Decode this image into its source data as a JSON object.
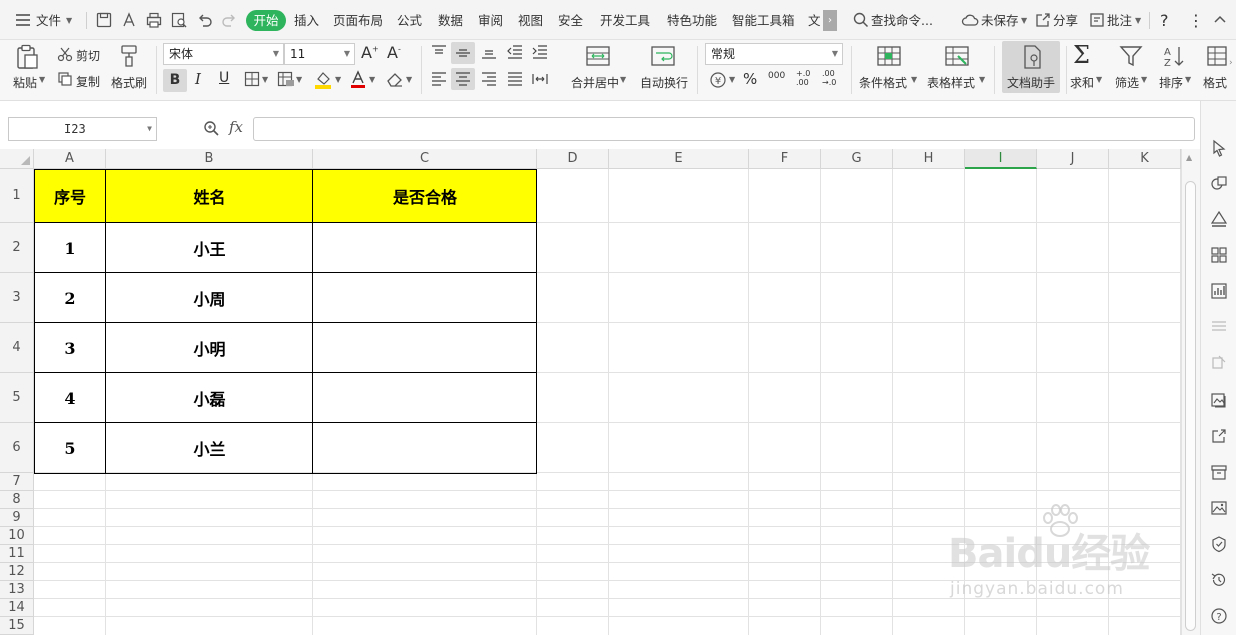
{
  "menubar": {
    "file_label": "文件",
    "tabs": [
      "开始",
      "插入",
      "页面布局",
      "公式",
      "数据",
      "审阅",
      "视图",
      "安全",
      "开发工具",
      "特色功能",
      "智能工具箱",
      "文"
    ],
    "active_tab": "开始",
    "search_placeholder": "查找命令...",
    "unsaved_label": "未保存",
    "share_label": "分享",
    "comment_label": "批注",
    "help_label": "?"
  },
  "ribbon": {
    "paste": "粘贴",
    "cut": "剪切",
    "copy": "复制",
    "format_painter": "格式刷",
    "font_name": "宋体",
    "font_size": "11",
    "bold": "B",
    "italic": "I",
    "underline": "U",
    "merge_center": "合并居中",
    "wrap_text": "自动换行",
    "number_format": "常规",
    "currency": "¥",
    "percent": "%",
    "thousands": "000",
    "inc_decimal": "+.0\n.00",
    "dec_decimal": ".00\n→.0",
    "conditional_format": "条件格式",
    "table_style": "表格样式",
    "doc_assistant": "文档助手",
    "sum": "求和",
    "filter": "筛选",
    "sort": "排序",
    "format": "格式"
  },
  "formula_bar": {
    "cell_ref": "I23",
    "fx_label": "fx",
    "formula": ""
  },
  "sheet": {
    "columns": [
      "A",
      "B",
      "C",
      "D",
      "E",
      "F",
      "G",
      "H",
      "I",
      "J",
      "K"
    ],
    "selected_column": "I",
    "rows": [
      "1",
      "2",
      "3",
      "4",
      "5",
      "6",
      "7",
      "8",
      "9",
      "10",
      "11",
      "12",
      "13",
      "14",
      "15"
    ],
    "table_header": [
      "序号",
      "姓名",
      "是否合格"
    ],
    "table_rows": [
      [
        "1",
        "小王",
        ""
      ],
      [
        "2",
        "小周",
        ""
      ],
      [
        "3",
        "小明",
        ""
      ],
      [
        "4",
        "小磊",
        ""
      ],
      [
        "5",
        "小兰",
        ""
      ]
    ],
    "header_fill": "#ffff00"
  },
  "watermark": {
    "brand": "Baidu经验",
    "url": "jingyan.baidu.com"
  },
  "colors": {
    "accent_green": "#2db45c",
    "selection_green": "#2ca44a"
  }
}
